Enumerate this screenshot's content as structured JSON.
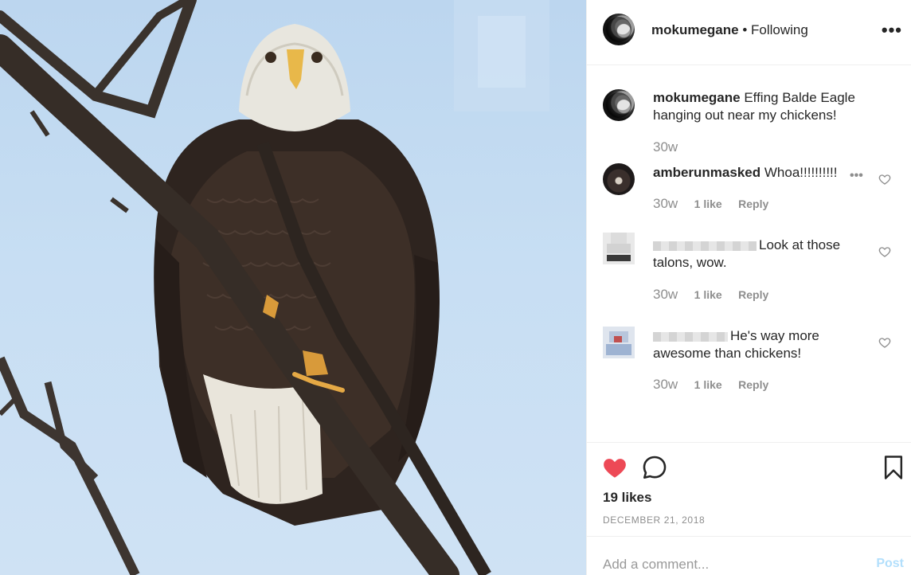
{
  "post": {
    "username": "mokumegane",
    "follow_status": "• Following",
    "more_label": "•••",
    "caption": "Effing Balde Eagle hanging out near my chickens!",
    "caption_time": "30w"
  },
  "comments": [
    {
      "username": "amberunmasked",
      "text": "Whoa!!!!!!!!!!",
      "time": "30w",
      "likes": "1 like",
      "reply": "Reply",
      "more": "•••"
    },
    {
      "username_blurred": true,
      "text": "Look at those talons, wow.",
      "time": "30w",
      "likes": "1 like",
      "reply": "Reply"
    },
    {
      "username_blurred": true,
      "text": "He's way more awesome than chickens!",
      "time": "30w",
      "likes": "1 like",
      "reply": "Reply"
    }
  ],
  "actions": {
    "likes": "19 likes",
    "date": "DECEMBER 21, 2018",
    "like_icon": "heart-icon",
    "comment_icon": "comment-bubble-icon",
    "save_icon": "bookmark-icon",
    "liked_color": "#ed4956"
  },
  "composer": {
    "placeholder": "Add a comment...",
    "post_label": "Post"
  }
}
